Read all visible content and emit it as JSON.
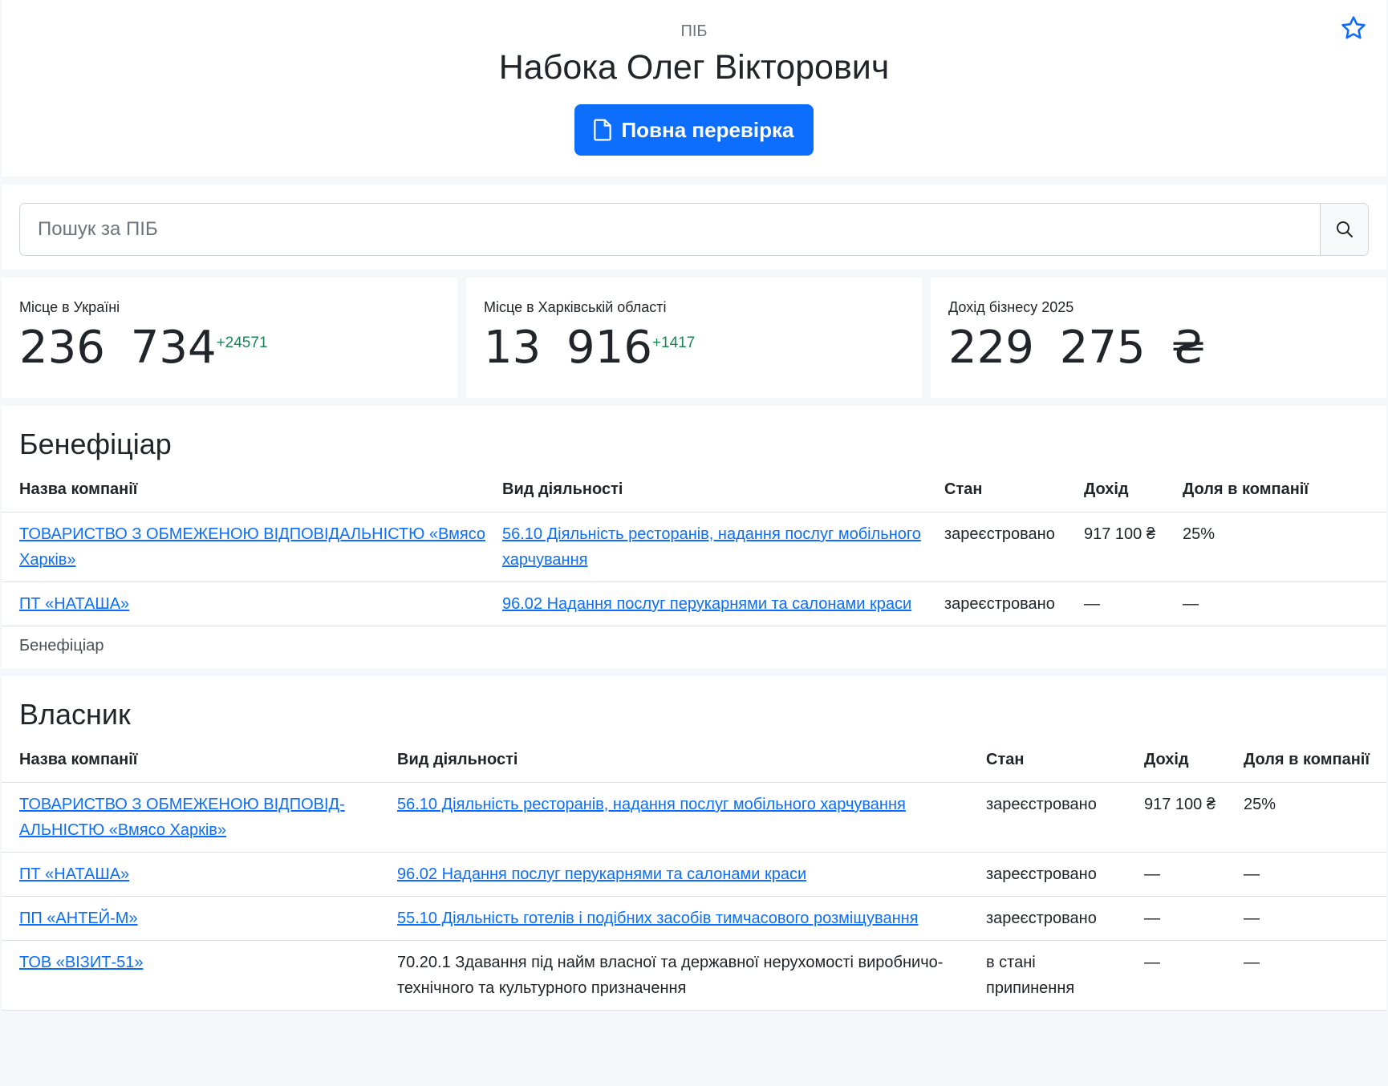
{
  "header": {
    "label": "ПІБ",
    "name": "Набока Олег Вікторович",
    "check_button": "Повна перевірка"
  },
  "search": {
    "placeholder": "Пошук за ПІБ"
  },
  "stats": [
    {
      "label": "Місце в Україні",
      "value": "236 734",
      "delta": "+24571"
    },
    {
      "label": "Місце в Харківській області",
      "value": "13 916",
      "delta": "+1417"
    },
    {
      "label": "Дохід бізнесу 2025",
      "value": "229 275 ₴",
      "delta": ""
    }
  ],
  "beneficiary": {
    "title": "Бенефіціар",
    "columns": [
      "Назва компанії",
      "Вид діяльності",
      "Стан",
      "Дохід",
      "Доля в компанії"
    ],
    "rows": [
      [
        "ТОВАРИСТВО З ОБМЕЖЕНОЮ ВІДПОВІДАЛЬНІСТЮ «Вмясо Харків»",
        "56.10 Діяльність ресторанів, надання послуг мобільного харчування",
        "зареєстровано",
        "917 100 ₴",
        "25%"
      ],
      [
        "ПТ «НАТАША»",
        "96.02 Надання послуг перукарнями та салонами краси",
        "зареєстровано",
        "—",
        "—"
      ]
    ],
    "caption": "Бенефіціар"
  },
  "owner": {
    "title": "Власник",
    "columns": [
      "Назва компанії",
      "Вид діяльності",
      "Стан",
      "Дохід",
      "Доля в компанії"
    ],
    "rows": [
      [
        "ТОВАРИСТВО З ОБМЕЖЕНОЮ ВІДПОВІД-АЛЬНІСТЮ «Вмясо Харків»",
        "56.10 Діяльність ресторанів, надання послуг мобільного харчування",
        "зареєстровано",
        "917 100 ₴",
        "25%"
      ],
      [
        "ПТ «НАТАША»",
        "96.02 Надання послуг перукарнями та салонами краси",
        "зареєстровано",
        "—",
        "—"
      ],
      [
        "ПП «АНТЕЙ-М»",
        "55.10 Діяльність готелів і подібних засобів тимчасового розміщування",
        "зареєстровано",
        "—",
        "—"
      ],
      [
        "ТОВ «ВІЗИТ-51»",
        "70.20.1 Здавання під найм власної та державної нерухомості виробничо-технічного та культурного призначення",
        "в стані припинення",
        "—",
        "—"
      ]
    ]
  }
}
